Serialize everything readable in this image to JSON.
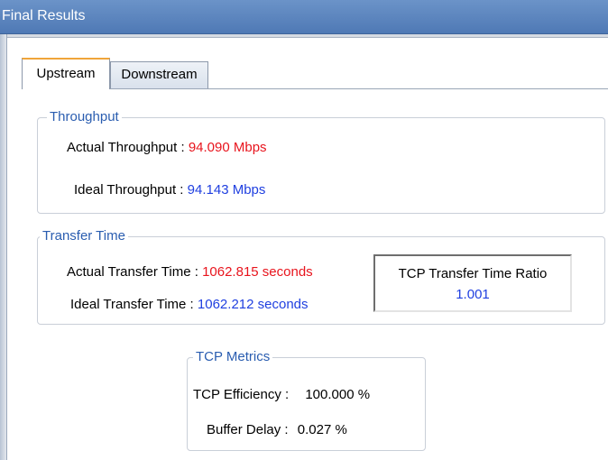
{
  "window": {
    "title": "Final Results"
  },
  "tabs": [
    {
      "label": "Upstream",
      "selected": true
    },
    {
      "label": "Downstream",
      "selected": false
    }
  ],
  "throughput": {
    "legend": "Throughput",
    "actual_label": "Actual Throughput :",
    "actual_value": "94.090 Mbps",
    "ideal_label": "Ideal Throughput :",
    "ideal_value": "94.143 Mbps"
  },
  "transfer_time": {
    "legend": "Transfer Time",
    "actual_label": "Actual Transfer Time :",
    "actual_value": "1062.815 seconds",
    "ideal_label": "Ideal Transfer Time  :",
    "ideal_value": "1062.212 seconds",
    "ratio_label": "TCP Transfer Time Ratio",
    "ratio_value": "1.001"
  },
  "tcp_metrics": {
    "legend": "TCP Metrics",
    "efficiency_label": "TCP Efficiency :",
    "efficiency_value": "100.000 %",
    "buffer_delay_label": "Buffer Delay :",
    "buffer_delay_value": "0.027 %"
  },
  "colors": {
    "accent_actual": "#e8141d",
    "accent_ideal": "#1f3fe0",
    "legend_text": "#2a5db0",
    "titlebar": "#5a84bf",
    "selected_tab_marker": "#f0a53a"
  }
}
